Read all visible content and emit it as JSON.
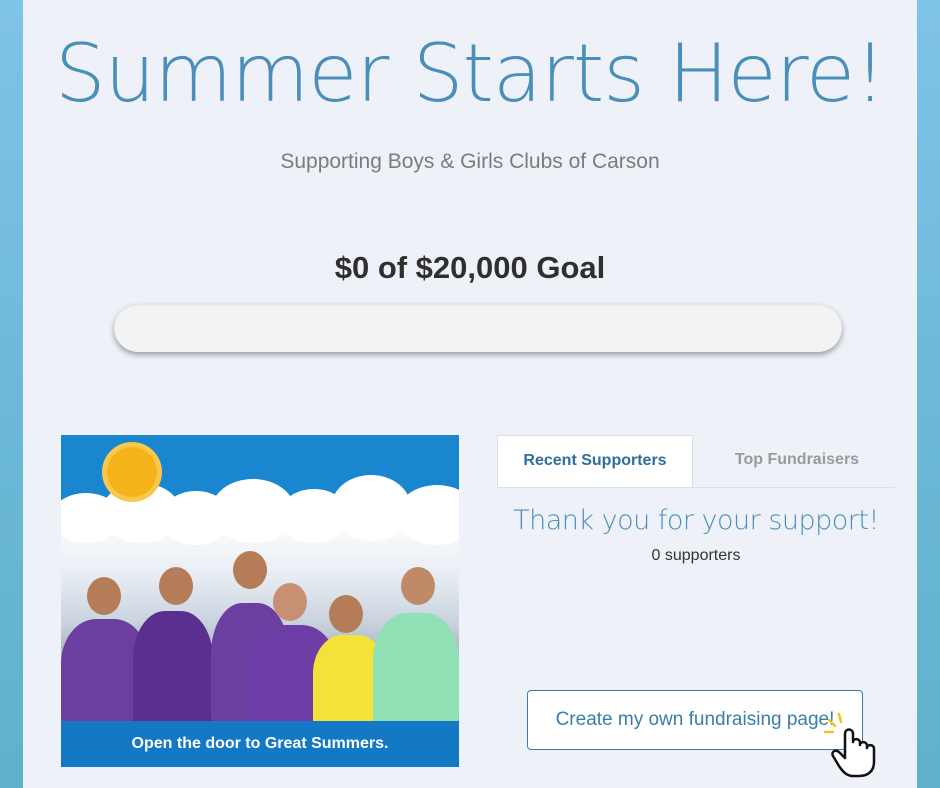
{
  "header": {
    "title": "Summer Starts Here!",
    "subtitle": "Supporting Boys & Girls Clubs of Carson"
  },
  "goal": {
    "label": "$0 of $20,000 Goal",
    "progress_fraction": 0
  },
  "promo": {
    "banner_text": "Open the door to Great Summers."
  },
  "tabs": [
    {
      "label": "Recent Supporters",
      "active": true
    },
    {
      "label": "Top Fundraisers",
      "active": false
    }
  ],
  "supporters": {
    "heading": "Thank you for your support!",
    "count_text": "0 supporters"
  },
  "cta": {
    "label": "Create my own fundraising page!"
  },
  "icons": {
    "pointer": "hand-pointer-icon",
    "sun": "sun-icon"
  },
  "colors": {
    "accent": "#4a8fba",
    "banner": "#1479c4"
  }
}
